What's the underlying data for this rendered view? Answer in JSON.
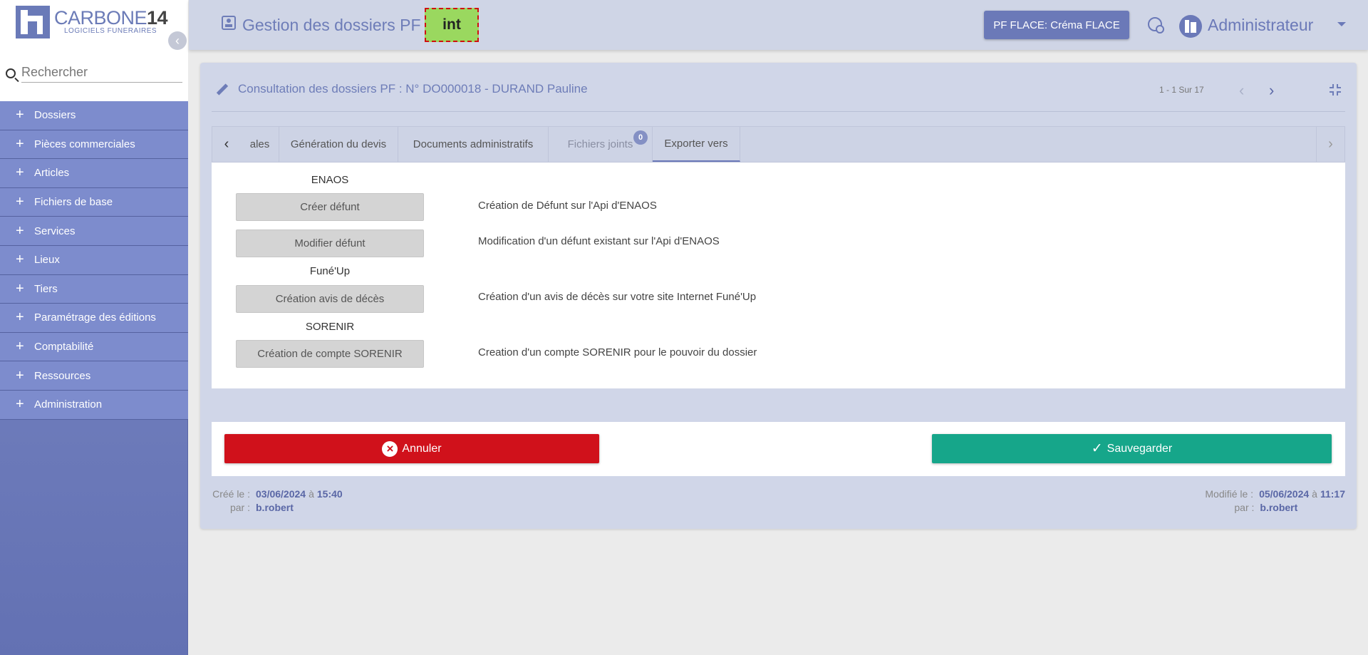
{
  "app": {
    "logo_main": "CARBONE",
    "logo_bold": "14",
    "logo_sub": "LOGICIELS FUNERAIRES"
  },
  "sidebar": {
    "search_placeholder": "Rechercher",
    "items": [
      {
        "label": "Dossiers"
      },
      {
        "label": "Pièces commerciales"
      },
      {
        "label": "Articles"
      },
      {
        "label": "Fichiers de base"
      },
      {
        "label": "Services"
      },
      {
        "label": "Lieux"
      },
      {
        "label": "Tiers"
      },
      {
        "label": "Paramétrage des éditions"
      },
      {
        "label": "Comptabilité"
      },
      {
        "label": "Ressources"
      },
      {
        "label": "Administration"
      }
    ]
  },
  "header": {
    "title": "Gestion des dossiers PF",
    "env_badge": "int",
    "pf_button": "PF FLACE: Créma FLACE",
    "user": "Administrateur"
  },
  "record": {
    "title": "Consultation des dossiers PF : N° DO000018 - DURAND Pauline",
    "pager": "1 - 1 Sur 17"
  },
  "tabs": [
    {
      "label": "ales"
    },
    {
      "label": "Génération du devis"
    },
    {
      "label": "Documents administratifs"
    },
    {
      "label": "Fichiers joints",
      "badge": "0"
    },
    {
      "label": "Exporter vers"
    }
  ],
  "export": {
    "sections": [
      {
        "title": "ENAOS"
      },
      {
        "title": "Funé'Up"
      },
      {
        "title": "SORENIR"
      }
    ],
    "actions": [
      {
        "button": "Créer défunt",
        "description": "Création de Défunt sur l'Api d'ENAOS"
      },
      {
        "button": "Modifier défunt",
        "description": "Modification d'un défunt existant sur l'Api d'ENAOS"
      },
      {
        "button": "Création avis de décès",
        "description": "Création d'un avis de décès sur votre site Internet Funé'Up"
      },
      {
        "button": "Création de compte SORENIR",
        "description": "Creation d'un compte SORENIR pour le pouvoir du dossier"
      }
    ]
  },
  "footer": {
    "cancel_label": "Annuler",
    "save_label": "Sauvegarder"
  },
  "meta": {
    "created_label": "Créé le :",
    "created_date": "03/06/2024",
    "created_at": "à",
    "created_time": "15:40",
    "created_by_label": "par :",
    "created_by": "b.robert",
    "modified_label": "Modifié le :",
    "modified_date": "05/06/2024",
    "modified_at": "à",
    "modified_time": "11:17",
    "modified_by_label": "par :",
    "modified_by": "b.robert"
  },
  "colors": {
    "accent": "#6b79b8",
    "sidebar": "#7d8ccd",
    "cancel": "#d0111b",
    "save": "#16a68a",
    "env_badge": "#9ad85f"
  },
  "icons": {
    "search": "search-icon",
    "page": "contact-card-icon",
    "globe": "globe-search-icon",
    "pencil": "pencil-icon",
    "compress": "compress-icon",
    "cancel": "close-circle-icon",
    "save": "check-icon"
  }
}
